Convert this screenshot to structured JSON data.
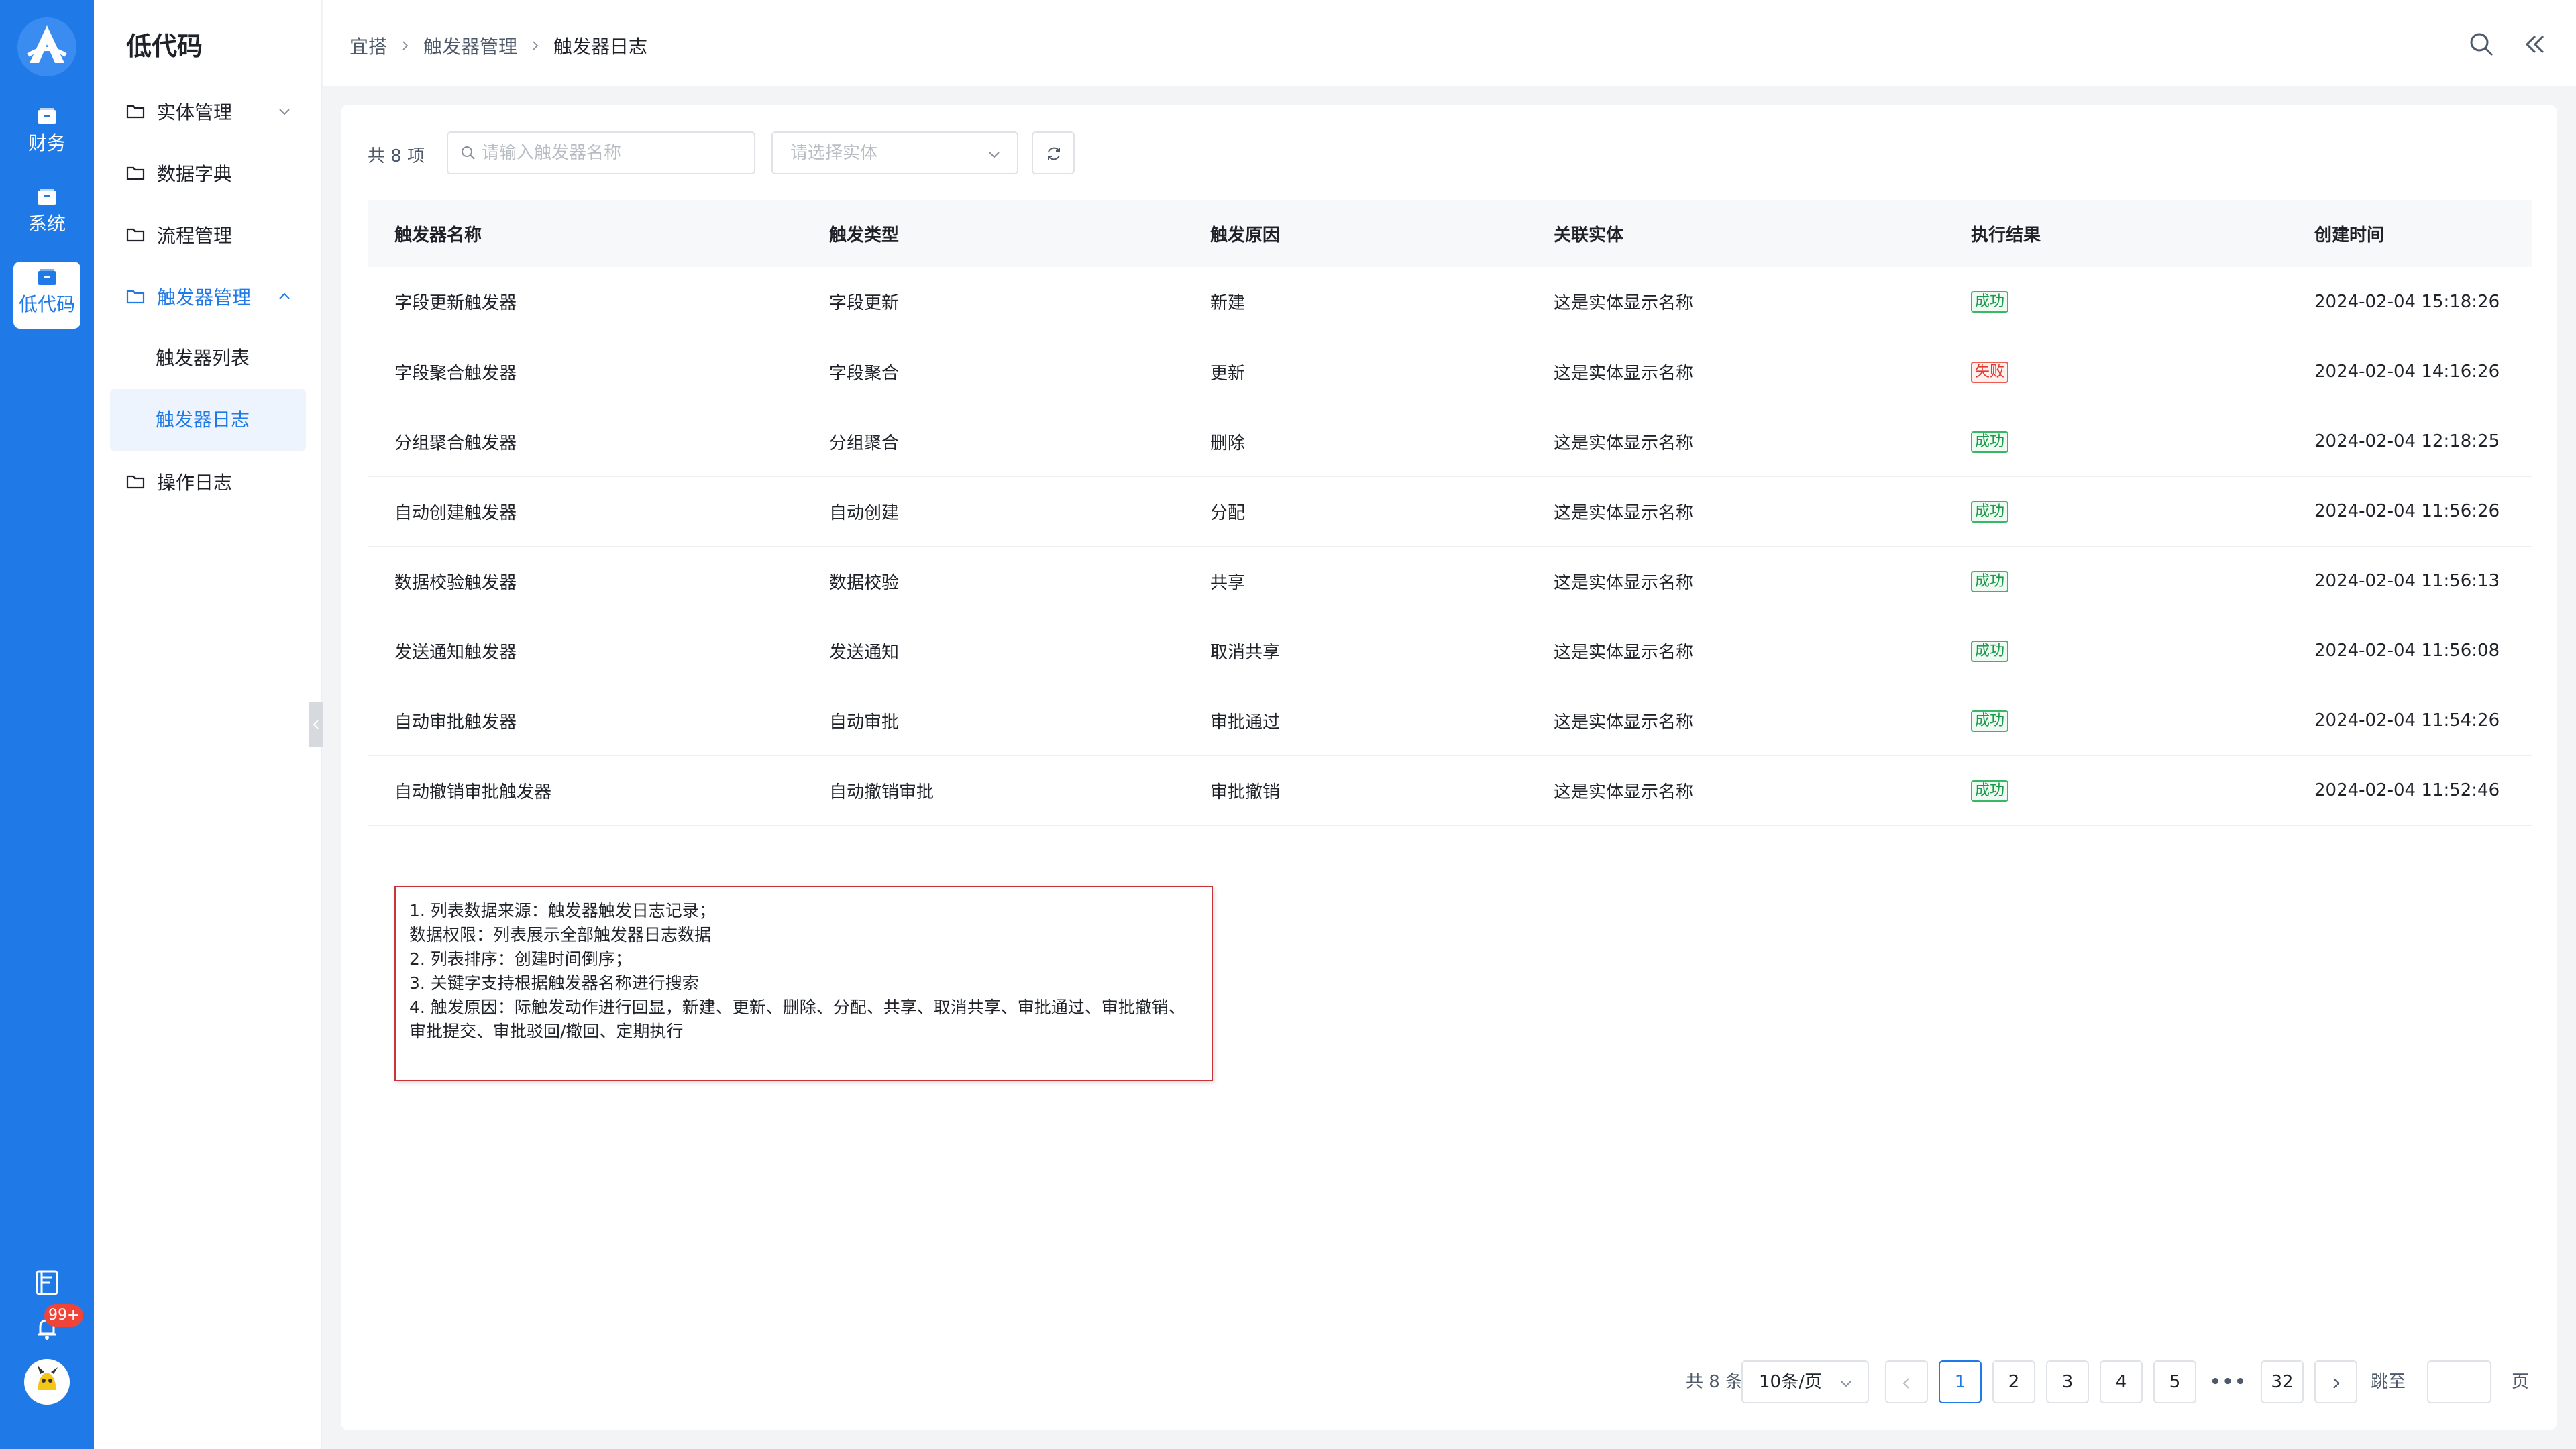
{
  "rail": {
    "items": [
      {
        "label": "财务",
        "icon": "wallet-icon"
      },
      {
        "label": "系统",
        "icon": "wallet-icon"
      },
      {
        "label": "低代码",
        "icon": "wallet-icon"
      }
    ],
    "notification_badge": "99+",
    "accent": "#1f7ae8"
  },
  "nav": {
    "title": "低代码",
    "items": [
      {
        "label": "实体管理"
      },
      {
        "label": "数据字典"
      },
      {
        "label": "流程管理"
      },
      {
        "label": "触发器管理"
      },
      {
        "label": "操作日志"
      }
    ],
    "sub_items": [
      {
        "label": "触发器列表"
      },
      {
        "label": "触发器日志"
      }
    ]
  },
  "breadcrumb": [
    "宜搭",
    "触发器管理",
    "触发器日志"
  ],
  "toolbar": {
    "count": "共 8 项",
    "search_placeholder": "请输入触发器名称",
    "entity_placeholder": "请选择实体"
  },
  "table": {
    "columns": [
      "触发器名称",
      "触发类型",
      "触发原因",
      "关联实体",
      "执行结果",
      "创建时间"
    ],
    "rows": [
      {
        "name": "字段更新触发器",
        "type": "字段更新",
        "reason": "新建",
        "entity": "这是实体显示名称",
        "result": "成功",
        "status": "ok",
        "time": "2024-02-04 15:18:26"
      },
      {
        "name": "字段聚合触发器",
        "type": "字段聚合",
        "reason": "更新",
        "entity": "这是实体显示名称",
        "result": "失败",
        "status": "fail",
        "time": "2024-02-04 14:16:26"
      },
      {
        "name": "分组聚合触发器",
        "type": "分组聚合",
        "reason": "删除",
        "entity": "这是实体显示名称",
        "result": "成功",
        "status": "ok",
        "time": "2024-02-04 12:18:25"
      },
      {
        "name": "自动创建触发器",
        "type": "自动创建",
        "reason": "分配",
        "entity": "这是实体显示名称",
        "result": "成功",
        "status": "ok",
        "time": "2024-02-04 11:56:26"
      },
      {
        "name": "数据校验触发器",
        "type": "数据校验",
        "reason": "共享",
        "entity": "这是实体显示名称",
        "result": "成功",
        "status": "ok",
        "time": "2024-02-04 11:56:13"
      },
      {
        "name": "发送通知触发器",
        "type": "发送通知",
        "reason": "取消共享",
        "entity": "这是实体显示名称",
        "result": "成功",
        "status": "ok",
        "time": "2024-02-04 11:56:08"
      },
      {
        "name": "自动审批触发器",
        "type": "自动审批",
        "reason": "审批通过",
        "entity": "这是实体显示名称",
        "result": "成功",
        "status": "ok",
        "time": "2024-02-04 11:54:26"
      },
      {
        "name": "自动撤销审批触发器",
        "type": "自动撤销审批",
        "reason": "审批撤销",
        "entity": "这是实体显示名称",
        "result": "成功",
        "status": "ok",
        "time": "2024-02-04 11:52:46"
      }
    ]
  },
  "note": "1. 列表数据来源：触发器触发日志记录；\n数据权限：列表展示全部触发器日志数据\n2. 列表排序：创建时间倒序；\n3. 关键字支持根据触发器名称进行搜索\n4. 触发原因：际触发动作进行回显，新建、更新、删除、分配、共享、取消共享、审批通过、审批撤销、审批提交、审批驳回/撤回、定期执行",
  "pagination": {
    "total": "共 8 条",
    "page_size": "10条/页",
    "pages": [
      "1",
      "2",
      "3",
      "4",
      "5"
    ],
    "last_page": "32",
    "current": "1",
    "jump_label": "跳至",
    "page_suffix": "页"
  }
}
